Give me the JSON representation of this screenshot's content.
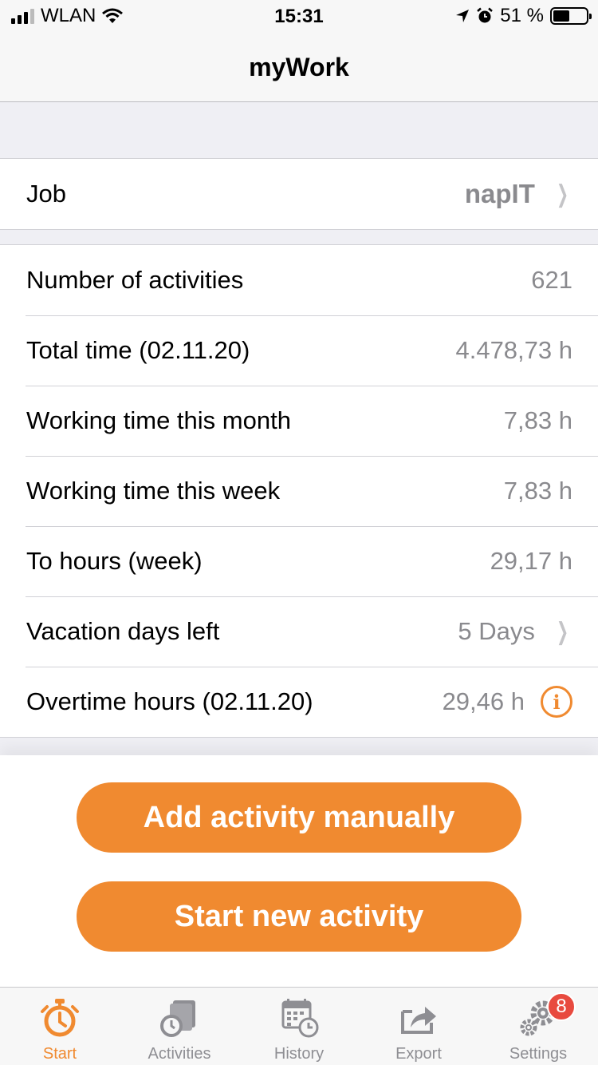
{
  "status_bar": {
    "carrier": "WLAN",
    "time": "15:31",
    "battery": "51 %"
  },
  "nav": {
    "title": "myWork"
  },
  "job": {
    "label": "Job",
    "value": "napIT"
  },
  "stats": [
    {
      "label": "Number of activities",
      "value": "621"
    },
    {
      "label": "Total time (02.11.20)",
      "value": "4.478,73 h"
    },
    {
      "label": "Working time this month",
      "value": "7,83 h"
    },
    {
      "label": "Working time this week",
      "value": "7,83 h"
    },
    {
      "label": "To hours (week)",
      "value": "29,17 h"
    },
    {
      "label": "Vacation days left",
      "value": "5 Days"
    },
    {
      "label": "Overtime hours (02.11.20)",
      "value": "29,46 h"
    }
  ],
  "actions": {
    "add_manual": "Add activity manually",
    "start_new": "Start new activity"
  },
  "tabs": [
    {
      "label": "Start",
      "icon": "stopwatch-icon",
      "active": true
    },
    {
      "label": "Activities",
      "icon": "activities-icon"
    },
    {
      "label": "History",
      "icon": "calendar-clock-icon"
    },
    {
      "label": "Export",
      "icon": "export-icon"
    },
    {
      "label": "Settings",
      "icon": "gears-icon",
      "badge": "8"
    }
  ],
  "colors": {
    "accent": "#f08a30",
    "badge": "#e84a3f"
  }
}
